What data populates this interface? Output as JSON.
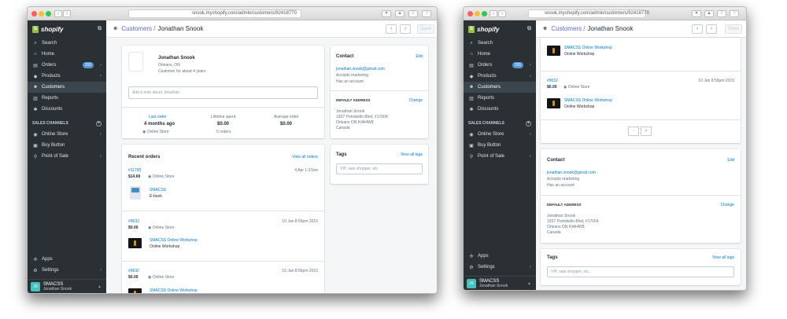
{
  "browser": {
    "url_left": "snook.myshopify.com/admin/customers/92418770",
    "url_right": "snook.myshopify.com/admin/customers/92418770"
  },
  "sidebar": {
    "brand": "shopify",
    "items": [
      {
        "label": "Search",
        "icon": "search-icon"
      },
      {
        "label": "Home",
        "icon": "home-icon"
      },
      {
        "label": "Orders",
        "icon": "orders-icon",
        "badge": "155"
      },
      {
        "label": "Products",
        "icon": "products-icon"
      },
      {
        "label": "Customers",
        "icon": "customers-icon"
      },
      {
        "label": "Reports",
        "icon": "reports-icon"
      },
      {
        "label": "Discounts",
        "icon": "discounts-icon"
      }
    ],
    "channels_heading": "SALES CHANNELS",
    "channels": [
      {
        "label": "Online Store"
      },
      {
        "label": "Buy Button"
      },
      {
        "label": "Point of Sale"
      }
    ],
    "bottom": [
      {
        "label": "Apps"
      },
      {
        "label": "Settings"
      }
    ],
    "store": {
      "initials": "JS",
      "name": "SMACSS",
      "owner": "Jonathan Snook"
    }
  },
  "header": {
    "crumb": "Customers /",
    "title": "Jonathan Snook",
    "save": "Save"
  },
  "customer": {
    "name": "Jonathan Snook",
    "location": "Orleans, ON",
    "since": "Customer for about 4 years",
    "note_placeholder": "Add a note about Jonathan",
    "last_order_label": "Last order",
    "last_order_value": "4 months ago",
    "last_order_channel": "Online Store",
    "lifetime_label": "Lifetime spent",
    "lifetime_value": "$0.00",
    "lifetime_count": "5 orders",
    "avg_label": "Average order",
    "avg_value": "$0.00"
  },
  "recent_orders": {
    "title": "Recent orders",
    "view_all": "View all orders",
    "orders": [
      {
        "number": "#11700",
        "amount": "$14.69",
        "channel": "Online Store",
        "date": "4 Apr 1:37pm",
        "product": "SMACSS",
        "variant": "E-book"
      },
      {
        "number": "#9633",
        "amount": "$0.00",
        "channel": "Online Store",
        "date": "10 Jan 8:56pm 2015",
        "product": "SMACSS Online Workshop",
        "variant": "Online Workshop"
      },
      {
        "number": "#9632",
        "amount": "$0.00",
        "channel": "Online Store",
        "date": "10 Jan 8:56pm 2015",
        "product": "SMACSS Online Workshop",
        "variant": "Online Workshop"
      }
    ]
  },
  "contact": {
    "title": "Contact",
    "edit": "Edit",
    "email": "jonathan.snook@gmail.com",
    "marketing": "Accepts marketing",
    "account": "Has an account",
    "address_title": "DEFAULT ADDRESS",
    "change": "Change",
    "address": [
      "Jonathan Snook",
      "1937 Portobello Blvd, #17004",
      "Orleans ON K4A4W8",
      "Canada"
    ]
  },
  "tags": {
    "title": "Tags",
    "view_all": "View all tags",
    "placeholder": "VIP, sale shopper, etc."
  }
}
